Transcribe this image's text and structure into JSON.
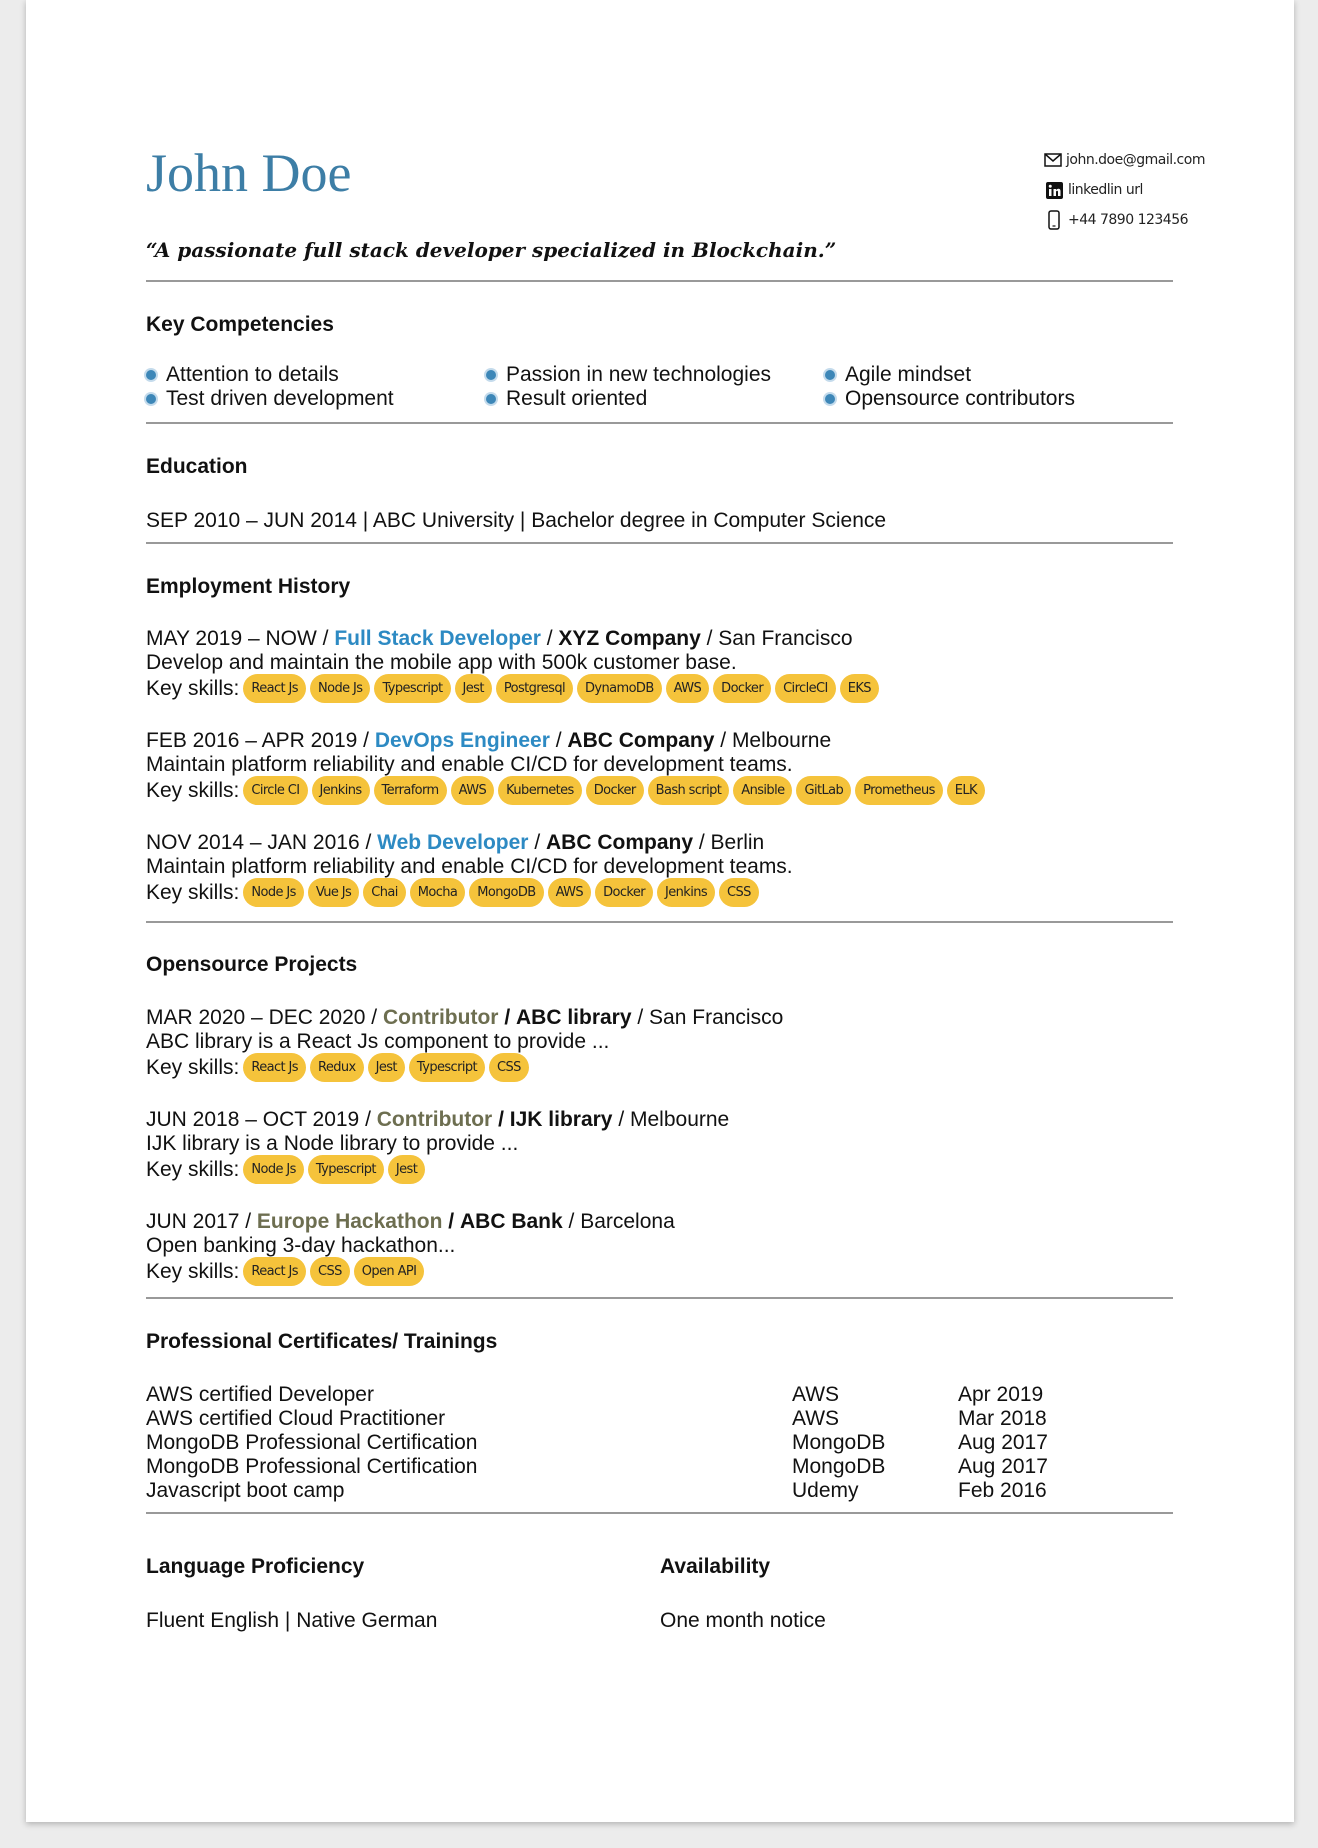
{
  "header": {
    "name": "John Doe",
    "tagline": "“A passionate full stack developer specialized in Blockchain.”",
    "contact": {
      "email": "john.doe@gmail.com",
      "linkedin": "linkedlin url",
      "phone": "+44 7890 123456"
    }
  },
  "competencies": {
    "title": "Key Competencies",
    "items": [
      "Attention to details",
      "Passion in new technologies",
      "Agile mindset",
      "Test driven development",
      "Result oriented",
      "Opensource contributors"
    ]
  },
  "education": {
    "title": "Education",
    "entry": "SEP 2010 – JUN 2014 | ABC University | Bachelor degree in Computer Science"
  },
  "employment": {
    "title": "Employment History",
    "skills_label": "Key skills:",
    "jobs": [
      {
        "dates": "MAY 2019 – NOW",
        "role": "Full Stack Developer",
        "company": "XYZ Company",
        "location": "San Francisco",
        "description": "Develop and maintain the mobile app with 500k customer base.",
        "skills": [
          "React Js",
          "Node Js",
          "Typescript",
          "Jest",
          "Postgresql",
          "DynamoDB",
          "AWS",
          "Docker",
          "CircleCI",
          "EKS"
        ]
      },
      {
        "dates": "FEB 2016 – APR 2019",
        "role": "DevOps Engineer",
        "company": "ABC Company",
        "location": "Melbourne",
        "description": "Maintain platform reliability and enable CI/CD for development teams.",
        "skills": [
          "Circle CI",
          "Jenkins",
          "Terraform",
          "AWS",
          "Kubernetes",
          "Docker",
          "Bash script",
          "Ansible",
          "GitLab",
          "Prometheus",
          "ELK"
        ]
      },
      {
        "dates": "NOV 2014 – JAN 2016",
        "role": "Web Developer",
        "company": "ABC Company",
        "location": "Berlin",
        "description": "Maintain platform reliability and enable CI/CD for development teams.",
        "skills": [
          "Node Js",
          "Vue Js",
          "Chai",
          "Mocha",
          "MongoDB",
          "AWS",
          "Docker",
          "Jenkins",
          "CSS"
        ]
      }
    ]
  },
  "projects": {
    "title": "Opensource Projects",
    "skills_label": "Key skills:",
    "items": [
      {
        "dates": "MAR 2020 – DEC 2020",
        "role": "Contributor",
        "org": "ABC library",
        "location": "San Francisco",
        "description": "ABC library is a React Js component to provide ...",
        "skills": [
          "React Js",
          "Redux",
          "Jest",
          "Typescript",
          "CSS"
        ]
      },
      {
        "dates": "JUN 2018 – OCT 2019",
        "role": "Contributor",
        "org": "IJK library",
        "location": "Melbourne",
        "description": "IJK library is a Node library to provide ...",
        "skills": [
          "Node Js",
          "Typescript",
          "Jest"
        ]
      },
      {
        "dates": "JUN 2017",
        "role": "Europe Hackathon",
        "org": "ABC Bank",
        "location": "Barcelona",
        "description": "Open banking 3-day hackathon...",
        "skills": [
          "React Js",
          "CSS",
          "Open API"
        ]
      }
    ]
  },
  "certificates": {
    "title": "Professional Certificates/ Trainings",
    "rows": [
      {
        "name": "AWS certified Developer",
        "issuer": "AWS",
        "date": "Apr 2019"
      },
      {
        "name": "AWS certified Cloud Practitioner",
        "issuer": "AWS",
        "date": "Mar 2018"
      },
      {
        "name": "MongoDB Professional Certification",
        "issuer": "MongoDB",
        "date": "Aug 2017"
      },
      {
        "name": "MongoDB Professional Certification",
        "issuer": "MongoDB",
        "date": "Aug 2017"
      },
      {
        "name": "Javascript boot camp",
        "issuer": "Udemy",
        "date": "Feb 2016"
      }
    ]
  },
  "language": {
    "title": "Language Proficiency",
    "value": "Fluent English | Native German"
  },
  "availability": {
    "title": "Availability",
    "value": "One month notice"
  },
  "colors": {
    "name": "#3d7ea6",
    "role_blue": "#2d8ac3",
    "role_olive": "#6d6e50",
    "chip": "#f5c33b",
    "bullet": "#3d87b8",
    "rule": "#999999"
  },
  "icons": {
    "email": "envelope-icon",
    "linkedin": "linkedin-icon",
    "phone": "mobile-phone-icon"
  }
}
